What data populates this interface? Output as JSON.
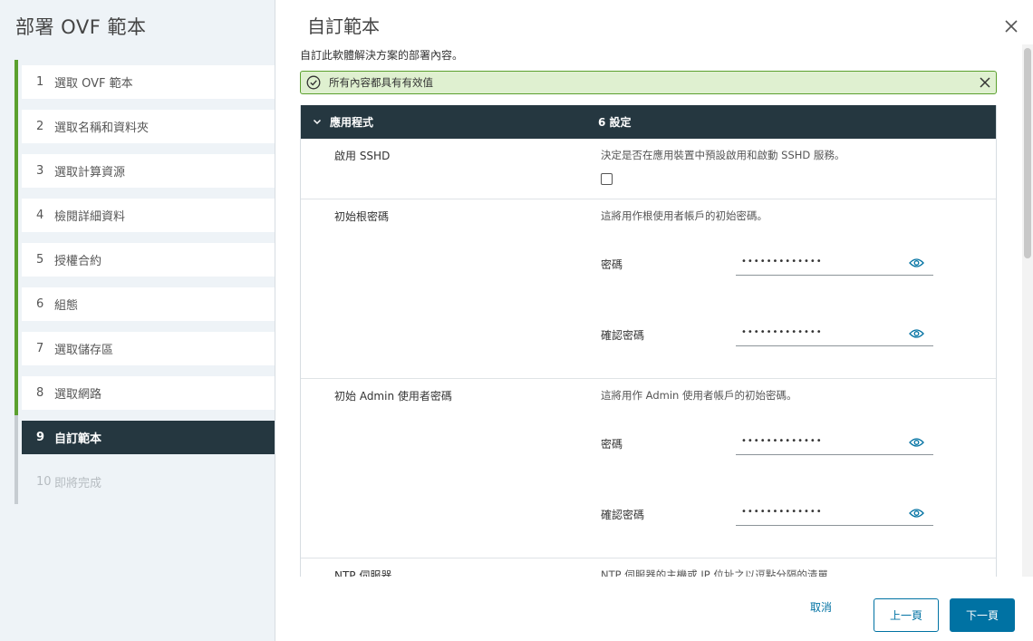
{
  "sidebar": {
    "title": "部署 OVF 範本",
    "steps": [
      {
        "num": "1",
        "label": "選取 OVF 範本"
      },
      {
        "num": "2",
        "label": "選取名稱和資料夾"
      },
      {
        "num": "3",
        "label": "選取計算資源"
      },
      {
        "num": "4",
        "label": "檢閱詳細資料"
      },
      {
        "num": "5",
        "label": "授權合約"
      },
      {
        "num": "6",
        "label": "組態"
      },
      {
        "num": "7",
        "label": "選取儲存區"
      },
      {
        "num": "8",
        "label": "選取網路"
      },
      {
        "num": "9",
        "label": "自訂範本"
      },
      {
        "num": "10",
        "label": "即將完成"
      }
    ]
  },
  "main": {
    "title": "自訂範本",
    "description": "自訂此軟體解決方案的部署內容。",
    "alert": "所有內容都具有有效值",
    "table": {
      "group_label": "應用程式",
      "group_count": "6 設定",
      "rows": {
        "sshd": {
          "label": "啟用 SSHD",
          "desc": "決定是否在應用裝置中預設啟用和啟動 SSHD 服務。",
          "checked": false
        },
        "root_pw": {
          "label": "初始根密碼",
          "desc": "這將用作根使用者帳戶的初始密碼。",
          "password_label": "密碼",
          "confirm_label": "確認密碼",
          "password_value": "•••••••••••••",
          "confirm_value": "•••••••••••••"
        },
        "admin_pw": {
          "label": "初始 Admin 使用者密碼",
          "desc": "這將用作 Admin 使用者帳戶的初始密碼。",
          "password_label": "密碼",
          "confirm_label": "確認密碼",
          "password_value": "•••••••••••••",
          "confirm_value": "•••••••••••••"
        },
        "ntp": {
          "label": "NTP 伺服器",
          "desc": "NTP 伺服器的主機或 IP 位址之以逗點分隔的清單"
        }
      }
    }
  },
  "footer": {
    "cancel": "取消",
    "back": "上一頁",
    "next": "下一頁"
  },
  "colors": {
    "accent": "#0072a3",
    "active_step": "#253740",
    "success": "#5ba02e",
    "alert_bg": "#dff0d0"
  }
}
